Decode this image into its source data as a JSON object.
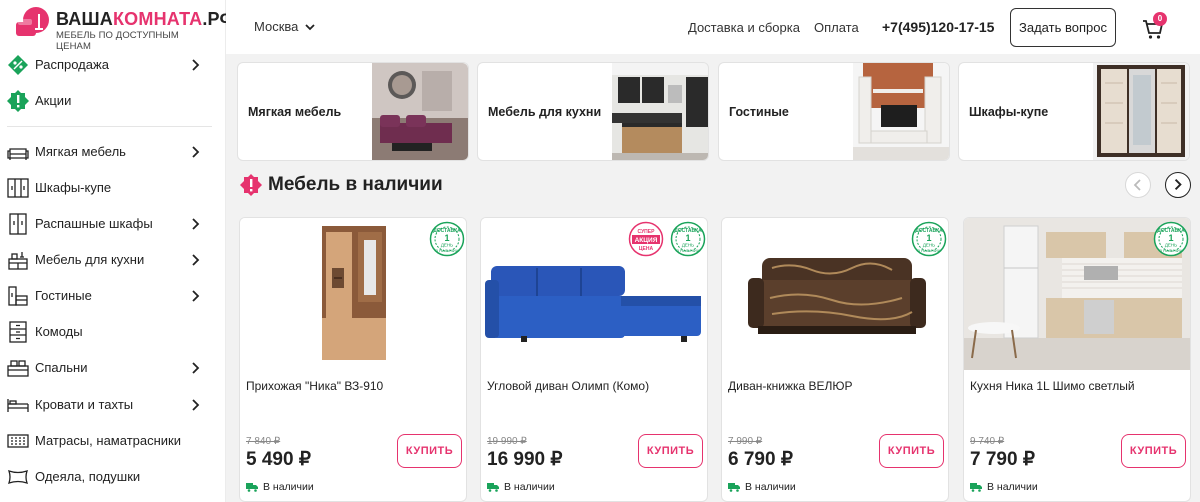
{
  "logo": {
    "title_main": "ВАША",
    "title_accent": "КОМНАТА",
    "title_end": ".РФ",
    "subtitle": "МЕБЕЛЬ ПО ДОСТУПНЫМ ЦЕНАМ"
  },
  "sidebar": {
    "items": [
      {
        "label": "Распродажа",
        "icon": "percent-tag-icon",
        "has_chevron": true
      },
      {
        "label": "Акции",
        "icon": "exclamation-badge-icon",
        "has_chevron": false
      },
      {
        "label": "Мягкая мебель",
        "icon": "sofa-icon",
        "has_chevron": true
      },
      {
        "label": "Шкафы-купе",
        "icon": "wardrobe-icon",
        "has_chevron": false
      },
      {
        "label": "Распашные шкафы",
        "icon": "cabinet-icon",
        "has_chevron": true
      },
      {
        "label": "Мебель для кухни",
        "icon": "kitchen-icon",
        "has_chevron": true
      },
      {
        "label": "Гостиные",
        "icon": "living-room-icon",
        "has_chevron": true
      },
      {
        "label": "Комоды",
        "icon": "dresser-icon",
        "has_chevron": false
      },
      {
        "label": "Спальни",
        "icon": "bedroom-icon",
        "has_chevron": true
      },
      {
        "label": "Кровати и тахты",
        "icon": "bed-icon",
        "has_chevron": true
      },
      {
        "label": "Матрасы, наматрасники",
        "icon": "mattress-icon",
        "has_chevron": false
      },
      {
        "label": "Одеяла, подушки",
        "icon": "pillow-icon",
        "has_chevron": false
      }
    ]
  },
  "header": {
    "city": "Москва",
    "links": [
      "Доставка и сборка",
      "Оплата"
    ],
    "phone": "+7(495)120-17-15",
    "ask_button": "Задать вопрос",
    "cart_count": "0"
  },
  "categories": [
    {
      "label": "Мягкая мебель"
    },
    {
      "label": "Мебель для кухни"
    },
    {
      "label": "Гостиные"
    },
    {
      "label": "Шкафы-купе"
    }
  ],
  "section": {
    "title": "Мебель в наличии"
  },
  "products": [
    {
      "name": "Прихожая \"Ника\" ВЗ-910",
      "old_price": "7 840 ₽",
      "price": "5 490 ₽",
      "buy": "КУПИТЬ",
      "stock": "В наличии"
    },
    {
      "name": "Угловой диван Олимп (Комо)",
      "old_price": "19 990 ₽",
      "price": "16 990 ₽",
      "buy": "КУПИТЬ",
      "stock": "В наличии"
    },
    {
      "name": "Диван-книжка ВЕЛЮР",
      "old_price": "7 990 ₽",
      "price": "6 790 ₽",
      "buy": "КУПИТЬ",
      "stock": "В наличии"
    },
    {
      "name": "Кухня Ника 1L Шимо светлый",
      "old_price": "9 740 ₽",
      "price": "7 790 ₽",
      "buy": "КУПИТЬ",
      "stock": "В наличии"
    }
  ],
  "badges": {
    "delivery_top": "ДОСТАВКА",
    "delivery_num": "1",
    "delivery_unit": "ДЕНЬ",
    "delivery_bottom": "В НАЛИЧИИ",
    "promo_top": "СУПЕР",
    "promo_mid": "АКЦИЯ",
    "promo_bottom": "ЦЕНА"
  },
  "colors": {
    "accent": "#e6336e",
    "green": "#1aa35a",
    "background": "#f2f2f2"
  }
}
